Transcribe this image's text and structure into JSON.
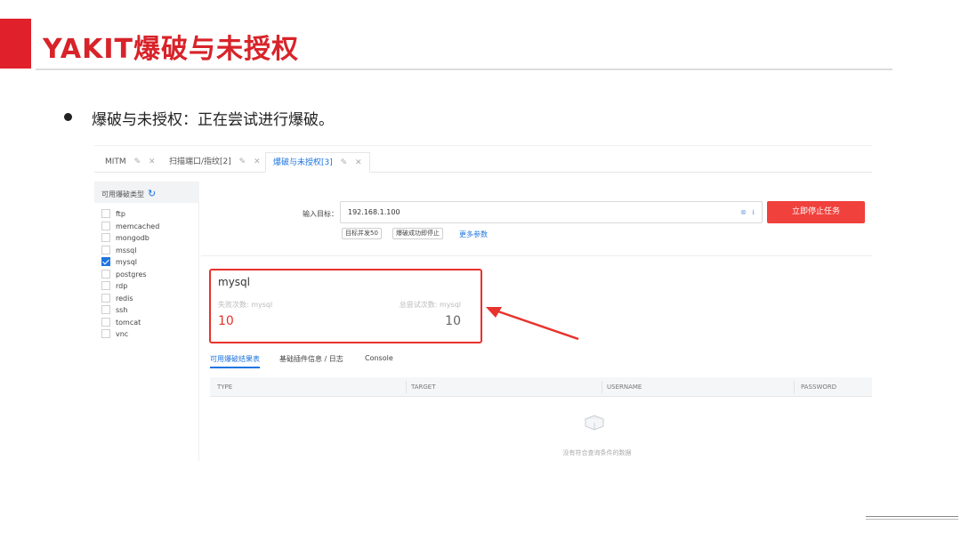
{
  "slide": {
    "title": "YAKIT爆破与未授权",
    "bullet": "爆破与未授权：正在尝试进行爆破。"
  },
  "app": {
    "tabs": [
      {
        "label": "MITM",
        "active": false
      },
      {
        "label": "扫描端口/指纹[2]",
        "active": false
      },
      {
        "label": "爆破与未授权[3]",
        "active": true
      }
    ],
    "sidebar": {
      "title": "可用爆破类型",
      "items": [
        {
          "label": "ftp",
          "checked": false
        },
        {
          "label": "memcached",
          "checked": false
        },
        {
          "label": "mongodb",
          "checked": false
        },
        {
          "label": "mssql",
          "checked": false
        },
        {
          "label": "mysql",
          "checked": true
        },
        {
          "label": "postgres",
          "checked": false
        },
        {
          "label": "rdp",
          "checked": false
        },
        {
          "label": "redis",
          "checked": false
        },
        {
          "label": "ssh",
          "checked": false
        },
        {
          "label": "tomcat",
          "checked": false
        },
        {
          "label": "vnc",
          "checked": false
        }
      ]
    },
    "form": {
      "target_label": "输入目标：",
      "target_value": "192.168.1.100",
      "stop_button": "立即停止任务",
      "option1": "目标并发50",
      "option2": "爆破成功即停止",
      "more_params": "更多参数"
    },
    "stats": {
      "name": "mysql",
      "fail_label": "失败次数: mysql",
      "fail_value": "10",
      "total_label": "总尝试次数: mysql",
      "total_value": "10"
    },
    "subtabs": [
      "可用爆破结果表",
      "基础插件信息 / 日志",
      "Console"
    ],
    "table": {
      "columns": [
        "TYPE",
        "TARGET",
        "USERNAME",
        "PASSWORD"
      ],
      "empty_text": "没有符合查询条件的数据"
    }
  },
  "colors": {
    "brand_red": "#d8232a",
    "accent_blue": "#1f75e0",
    "stop_button": "#f0413c"
  }
}
